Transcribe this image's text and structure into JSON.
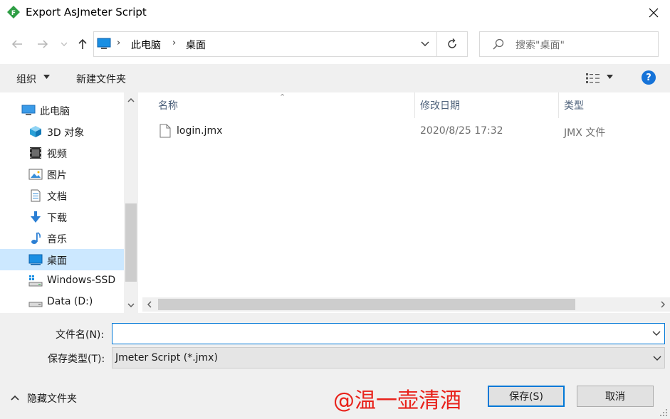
{
  "window": {
    "title": "Export AsJmeter Script"
  },
  "nav": {
    "breadcrumbs": [
      "此电脑",
      "桌面"
    ],
    "search_placeholder": "搜索\"桌面\""
  },
  "toolbar": {
    "organize_label": "组织",
    "new_folder_label": "新建文件夹",
    "help_label": "?"
  },
  "tree": {
    "items": [
      {
        "label": "此电脑",
        "icon": "pc-icon",
        "level": 0
      },
      {
        "label": "3D 对象",
        "icon": "cube-icon",
        "level": 1
      },
      {
        "label": "视频",
        "icon": "video-icon",
        "level": 1
      },
      {
        "label": "图片",
        "icon": "picture-icon",
        "level": 1
      },
      {
        "label": "文档",
        "icon": "document-icon",
        "level": 1
      },
      {
        "label": "下载",
        "icon": "download-icon",
        "level": 1
      },
      {
        "label": "音乐",
        "icon": "music-icon",
        "level": 1
      },
      {
        "label": "桌面",
        "icon": "desktop-icon",
        "level": 1,
        "selected": true
      },
      {
        "label": "Windows-SSD",
        "icon": "drive-icon",
        "level": 1
      },
      {
        "label": "Data (D:)",
        "icon": "drive-icon",
        "level": 1
      }
    ]
  },
  "list": {
    "columns": [
      "名称",
      "修改日期",
      "类型"
    ],
    "files": [
      {
        "name": "login.jmx",
        "modified": "2020/8/25 17:32",
        "type": "JMX 文件"
      }
    ]
  },
  "form": {
    "filename_label": "文件名(N):",
    "filename_value": "",
    "filetype_label": "保存类型(T):",
    "filetype_value": "Jmeter Script (*.jmx)"
  },
  "footer": {
    "hide_folders_label": "隐藏文件夹",
    "save_label": "保存(S)",
    "cancel_label": "取消",
    "watermark": "@温一壶清酒"
  },
  "colors": {
    "accent": "#0078d7",
    "selection": "#cce8ff",
    "watermark": "#e8221b"
  }
}
